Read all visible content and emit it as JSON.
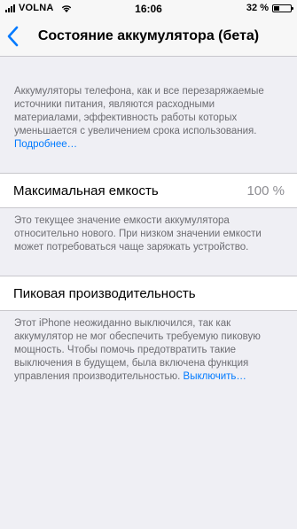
{
  "status_bar": {
    "carrier": "VOLNA",
    "time": "16:06",
    "battery_percent_label": "32 %",
    "battery_level": 0.32
  },
  "nav": {
    "back_icon": "chevron-left-icon",
    "title": "Состояние аккумулятора (бета)",
    "accent_color": "#007aff"
  },
  "intro": {
    "text": "Аккумуляторы телефона, как и все перезаряжаемые источники питания, являются расходными материалами, эффективность работы которых уменьшается с увеличением срока использования.",
    "link": "Подробнее…"
  },
  "max_capacity": {
    "label": "Максимальная емкость",
    "value": "100 %",
    "description": "Это текущее значение емкости аккумулятора относительно нового. При низком значении емкости может потребоваться чаще заряжать устройство."
  },
  "peak_performance": {
    "label": "Пиковая производительность",
    "description": "Этот iPhone неожиданно выключился, так как аккумулятор не мог обеспечить требуемую пиковую мощность. Чтобы помочь предотвратить такие выключения в будущем, была включена функция управления производительностью.",
    "link": "Выключить…"
  }
}
